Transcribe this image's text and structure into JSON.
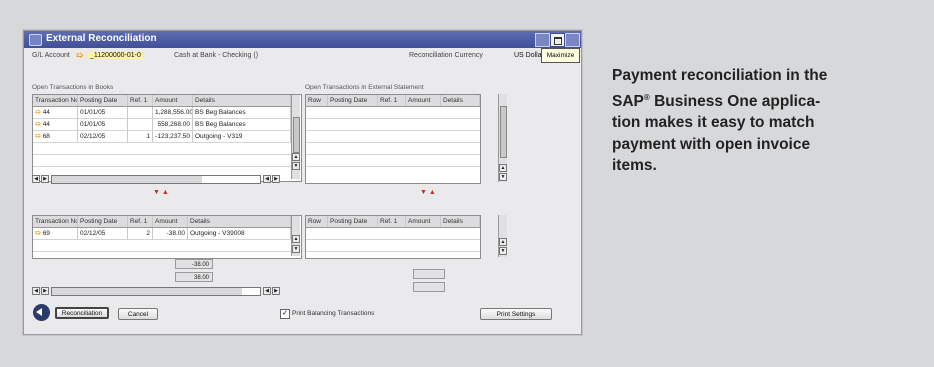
{
  "window": {
    "title": "External Reconciliation",
    "tooltip": "Maximize"
  },
  "header": {
    "gl_account_label": "G/L Account",
    "gl_account_value": "_11200000-01-0",
    "account_name": "Cash at Bank - Checking ()",
    "currency_label": "Reconciliation Currency",
    "currency_value": "US Dolla"
  },
  "books": {
    "section_label": "Open Transactions in Books",
    "columns": [
      "Transaction No.",
      "Posting Date",
      "Ref. 1",
      "Amount",
      "Details"
    ],
    "rows": [
      {
        "no": "44",
        "date": "01/01/05",
        "ref": "",
        "amount": "1,288,556.00",
        "details": "BS Beg Balances"
      },
      {
        "no": "44",
        "date": "01/01/05",
        "ref": "",
        "amount": "558,268.00",
        "details": "BS Beg Balances"
      },
      {
        "no": "68",
        "date": "02/12/05",
        "ref": "1",
        "amount": "-123,237.50",
        "details": "Outgoing - V319"
      }
    ]
  },
  "statement": {
    "section_label": "Open Transactions in External Statement",
    "columns": [
      "Row",
      "Posting Date",
      "Ref. 1",
      "Amount",
      "Details"
    ]
  },
  "selected_books": {
    "columns": [
      "Transaction No.",
      "Posting Date",
      "Ref. 1",
      "Amount",
      "Details"
    ],
    "rows": [
      {
        "no": "69",
        "date": "02/12/05",
        "ref": "2",
        "amount": "-38.00",
        "details": "Outgoing - V39008"
      }
    ],
    "totals": [
      "-38.00",
      "38.00"
    ]
  },
  "selected_statement": {
    "columns": [
      "Row",
      "Posting Date",
      "Ref. 1",
      "Amount",
      "Details"
    ]
  },
  "footer": {
    "reconcile_label": "Reconciliation",
    "cancel_label": "Cancel",
    "print_balancing_label": "Print Balancing Transactions",
    "print_settings_label": "Print Settings"
  },
  "caption": {
    "line1": "Payment reconciliation in the",
    "line2_a": "SAP",
    "line2_reg": "®",
    "line2_b": " Business One applica-",
    "line3": "tion makes it easy to match",
    "line4": "payment with open invoice",
    "line5": "items."
  }
}
